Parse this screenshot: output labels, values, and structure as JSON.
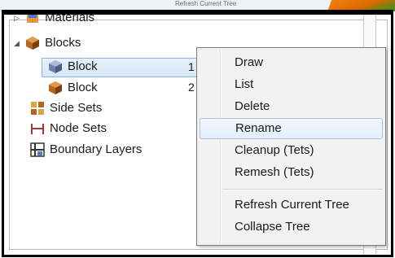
{
  "background": {
    "ghost_label": "Refresh Current Tree"
  },
  "tree": {
    "materials": {
      "label": "Materials"
    },
    "blocks": {
      "label": "Blocks"
    },
    "block_selected": {
      "label": "Block",
      "id": "1"
    },
    "block_2": {
      "label": "Block",
      "id": "2"
    },
    "side_sets": {
      "label": "Side Sets"
    },
    "node_sets": {
      "label": "Node Sets"
    },
    "boundary_layers": {
      "label": "Boundary Layers"
    }
  },
  "context_menu": {
    "items": [
      "Draw",
      "List",
      "Delete",
      "Rename",
      "Cleanup (Tets)",
      "Remesh (Tets)",
      "Refresh Current Tree",
      "Collapse Tree"
    ],
    "hovered_item": "Rename"
  },
  "colors": {
    "selection": "#d6e6f8",
    "menu_bg": "#f2f2f2",
    "highlight_border": "#a8c4e6"
  }
}
